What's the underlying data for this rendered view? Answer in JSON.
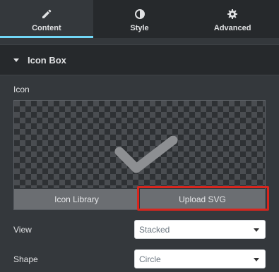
{
  "tabs": [
    {
      "label": "Content",
      "icon": "pencil-icon",
      "active": true
    },
    {
      "label": "Style",
      "icon": "contrast-icon",
      "active": false
    },
    {
      "label": "Advanced",
      "icon": "gear-icon",
      "active": false
    }
  ],
  "section": {
    "title": "Icon Box",
    "icon": "caret-down-icon"
  },
  "icon_field": {
    "label": "Icon",
    "preview_icon": "checkmark-icon",
    "library_button": "Icon Library",
    "upload_button": "Upload SVG"
  },
  "view_field": {
    "label": "View",
    "value": "Stacked"
  },
  "shape_field": {
    "label": "Shape",
    "value": "Circle"
  },
  "colors": {
    "accent": "#71d7f7",
    "highlight": "#d7261e",
    "panel": "#34383c"
  }
}
